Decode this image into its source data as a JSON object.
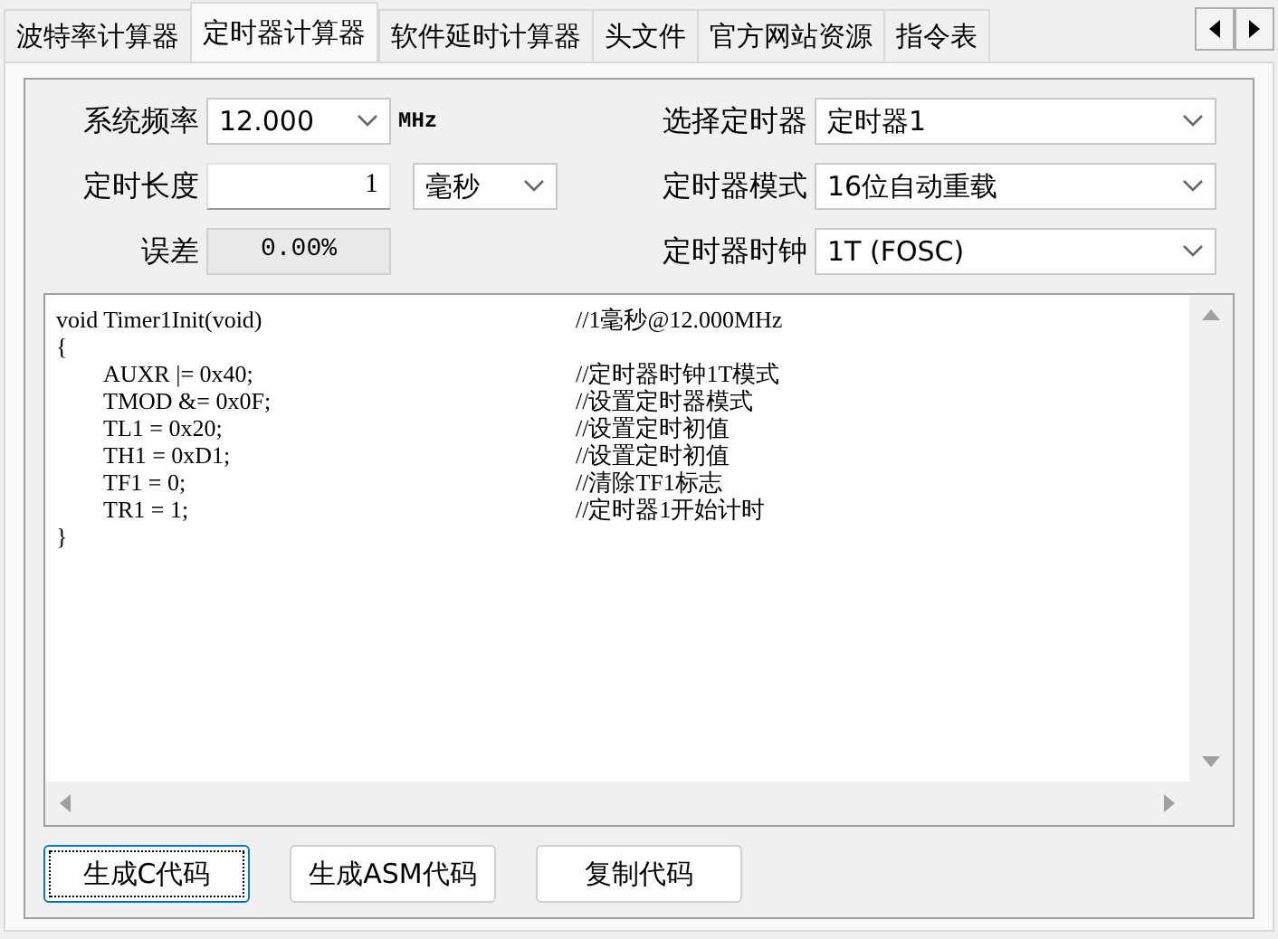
{
  "tabs": [
    {
      "label": "波特率计算器",
      "selected": false
    },
    {
      "label": "定时器计算器",
      "selected": true
    },
    {
      "label": "软件延时计算器",
      "selected": false
    },
    {
      "label": "头文件",
      "selected": false
    },
    {
      "label": "官方网站资源",
      "selected": false
    },
    {
      "label": "指令表",
      "selected": false
    }
  ],
  "form": {
    "left": [
      {
        "kind": "combo",
        "label": "系统频率",
        "value": "12.000",
        "unit": "MHz"
      },
      {
        "kind": "spin",
        "label": "定时长度",
        "value": "1",
        "unit_select": "毫秒"
      },
      {
        "kind": "readout",
        "label": "误差",
        "value": "0.00%"
      }
    ],
    "right": [
      {
        "label": "选择定时器",
        "value": "定时器1"
      },
      {
        "label": "定时器模式",
        "value": "16位自动重载"
      },
      {
        "label": "定时器时钟",
        "value": "1T  (FOSC)"
      }
    ]
  },
  "code": [
    {
      "code": "void Timer1Init(void)",
      "comment": "//1毫秒@12.000MHz"
    },
    {
      "code": "{"
    },
    {
      "code": "\tAUXR |= 0x40;",
      "comment": "//定时器时钟1T模式"
    },
    {
      "code": "\tTMOD &= 0x0F;",
      "comment": "//设置定时器模式"
    },
    {
      "code": "\tTL1 = 0x20;",
      "comment": "//设置定时初值"
    },
    {
      "code": "\tTH1 = 0xD1;",
      "comment": "//设置定时初值"
    },
    {
      "code": "\tTF1 = 0;",
      "comment": "//清除TF1标志"
    },
    {
      "code": "\tTR1 = 1;",
      "comment": "//定时器1开始计时"
    },
    {
      "code": "}"
    }
  ],
  "buttons": [
    {
      "label": "生成C代码",
      "focused": true
    },
    {
      "label": "生成ASM代码",
      "focused": false
    },
    {
      "label": "复制代码",
      "focused": false
    }
  ]
}
